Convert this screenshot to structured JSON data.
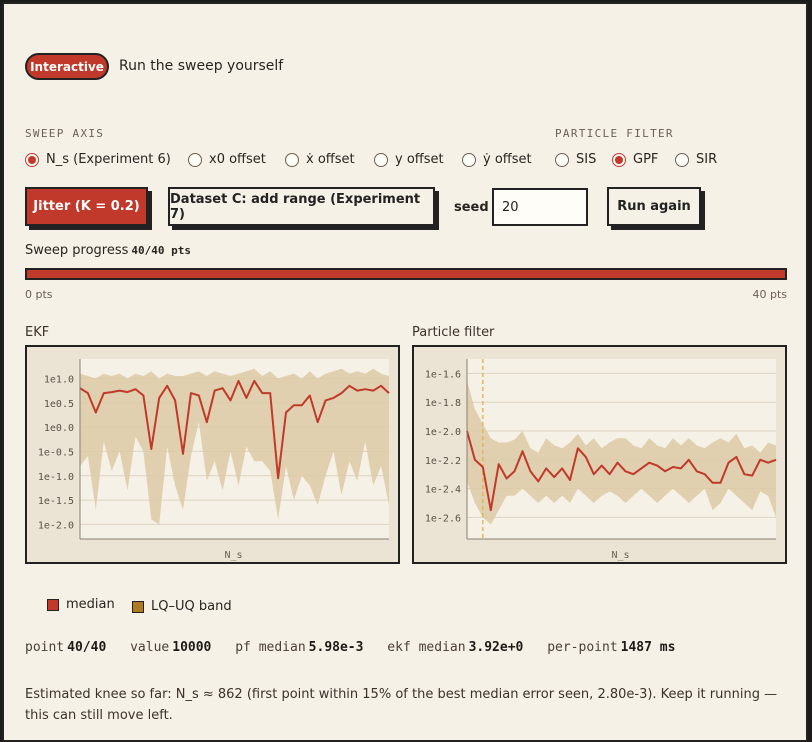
{
  "header": {
    "badge": "Interactive",
    "title": "Run the sweep yourself"
  },
  "sweep_axis": {
    "label": "SWEEP AXIS",
    "options": [
      "N_s (Experiment 6)",
      "x0 offset",
      "ẋ offset",
      "y offset",
      "ẏ offset"
    ],
    "selected": "N_s (Experiment 6)"
  },
  "particle_filter": {
    "label": "PARTICLE FILTER",
    "options": [
      "SIS",
      "GPF",
      "SIR"
    ],
    "selected": "GPF"
  },
  "controls": {
    "jitter": "Jitter (K = 0.2)",
    "dataset": "Dataset C: add range (Experiment 7)",
    "seed_label": "seed",
    "seed_value": "20",
    "run_again": "Run again"
  },
  "progress": {
    "label": "Sweep progress",
    "count": "40/40 pts",
    "fraction": 1.0,
    "min_label": "0 pts",
    "max_label": "40 pts"
  },
  "legend": {
    "median": "median",
    "band": "LQ–UQ band"
  },
  "stats": {
    "point_label": "point",
    "point": "40/40",
    "value_label": "value",
    "value": "10000",
    "pf_label": "pf median",
    "pf": "5.98e-3",
    "ekf_label": "ekf median",
    "ekf": "3.92e+0",
    "pp_label": "per-point",
    "pp": "1487 ms"
  },
  "note": "Estimated knee so far: N_s ≈ 862 (first point within 15% of the best median error seen, 2.80e-3). Keep it running — this can still move left.",
  "colors": {
    "accent": "#c0392b",
    "band": "#dccaa4",
    "band_swatch": "#b07a1e"
  },
  "chart_data": [
    {
      "type": "area",
      "title": "EKF",
      "xlabel": "N_s",
      "ylabel": "",
      "y_scale": "log10",
      "ylim": [
        -2.3,
        1.4
      ],
      "y_ticks": [
        "1e1.0",
        "1e0.5",
        "1e0.0",
        "1e-0.5",
        "1e-1.0",
        "1e-1.5",
        "1e-2.0"
      ],
      "grid": true,
      "series": [
        {
          "name": "median",
          "values": [
            0.8,
            0.7,
            0.3,
            0.7,
            0.72,
            0.75,
            0.72,
            0.78,
            0.65,
            -0.45,
            0.6,
            0.85,
            0.55,
            -0.55,
            0.7,
            0.65,
            0.1,
            0.75,
            0.8,
            0.55,
            0.95,
            0.6,
            0.95,
            0.7,
            0.7,
            -1.05,
            0.3,
            0.45,
            0.45,
            0.65,
            0.1,
            0.55,
            0.6,
            0.7,
            0.85,
            0.75,
            0.78,
            0.75,
            0.85,
            0.7
          ]
        },
        {
          "name": "LQ–UQ band (upper)",
          "values": [
            1.1,
            1.05,
            1.0,
            1.1,
            1.05,
            1.1,
            1.0,
            1.1,
            1.05,
            1.15,
            1.0,
            1.1,
            1.05,
            1.05,
            1.1,
            1.15,
            1.05,
            1.15,
            1.1,
            1.05,
            1.1,
            1.15,
            1.2,
            1.05,
            1.15,
            1.0,
            1.05,
            1.1,
            1.0,
            1.15,
            1.0,
            1.1,
            1.15,
            1.2,
            1.1,
            1.15,
            1.1,
            1.2,
            1.1,
            1.05
          ]
        },
        {
          "name": "LQ–UQ band (lower)",
          "values": [
            -0.8,
            -0.6,
            -1.7,
            -0.3,
            -0.9,
            -0.5,
            -1.3,
            -0.2,
            -0.5,
            -1.9,
            -2.0,
            -0.4,
            -1.2,
            -1.7,
            -0.6,
            0.1,
            -1.1,
            -0.7,
            -1.3,
            -0.5,
            -1.2,
            -0.4,
            -0.7,
            -0.7,
            -0.9,
            -1.9,
            -0.8,
            -1.5,
            -1.0,
            -1.2,
            -1.6,
            -1.0,
            -0.5,
            -1.4,
            -0.7,
            -1.1,
            -0.3,
            -1.2,
            -0.8,
            -1.6
          ]
        }
      ]
    },
    {
      "type": "area",
      "title": "Particle filter",
      "xlabel": "N_s",
      "ylabel": "",
      "y_scale": "log10",
      "ylim": [
        -2.75,
        -1.5
      ],
      "y_ticks": [
        "1e-1.6",
        "1e-1.8",
        "1e-2.0",
        "1e-2.2",
        "1e-2.4",
        "1e-2.6"
      ],
      "grid": true,
      "knee_index": 2,
      "series": [
        {
          "name": "median",
          "values": [
            -2.0,
            -2.2,
            -2.25,
            -2.55,
            -2.23,
            -2.33,
            -2.28,
            -2.14,
            -2.28,
            -2.35,
            -2.26,
            -2.32,
            -2.26,
            -2.34,
            -2.12,
            -2.18,
            -2.3,
            -2.24,
            -2.3,
            -2.22,
            -2.28,
            -2.3,
            -2.26,
            -2.22,
            -2.24,
            -2.28,
            -2.25,
            -2.26,
            -2.2,
            -2.28,
            -2.3,
            -2.36,
            -2.36,
            -2.22,
            -2.18,
            -2.3,
            -2.31,
            -2.2,
            -2.22,
            -2.2
          ]
        },
        {
          "name": "LQ–UQ band (upper)",
          "values": [
            -1.65,
            -1.85,
            -1.95,
            -2.05,
            -2.08,
            -2.08,
            -2.06,
            -2.0,
            -2.12,
            -2.15,
            -2.05,
            -2.1,
            -2.12,
            -2.08,
            -2.02,
            -2.1,
            -2.05,
            -2.12,
            -2.08,
            -2.05,
            -2.05,
            -2.1,
            -2.12,
            -2.05,
            -2.1,
            -2.12,
            -2.05,
            -2.1,
            -2.05,
            -2.1,
            -2.12,
            -2.08,
            -2.05,
            -2.08,
            -2.02,
            -2.12,
            -2.1,
            -2.15,
            -2.08,
            -2.1
          ]
        },
        {
          "name": "LQ–UQ band (lower)",
          "values": [
            -2.35,
            -2.5,
            -2.6,
            -2.65,
            -2.55,
            -2.45,
            -2.45,
            -2.4,
            -2.45,
            -2.5,
            -2.45,
            -2.5,
            -2.45,
            -2.5,
            -2.4,
            -2.45,
            -2.5,
            -2.45,
            -2.42,
            -2.45,
            -2.5,
            -2.45,
            -2.4,
            -2.45,
            -2.5,
            -2.45,
            -2.4,
            -2.45,
            -2.5,
            -2.45,
            -2.4,
            -2.55,
            -2.5,
            -2.4,
            -2.45,
            -2.5,
            -2.55,
            -2.42,
            -2.45,
            -2.6
          ]
        }
      ]
    }
  ]
}
